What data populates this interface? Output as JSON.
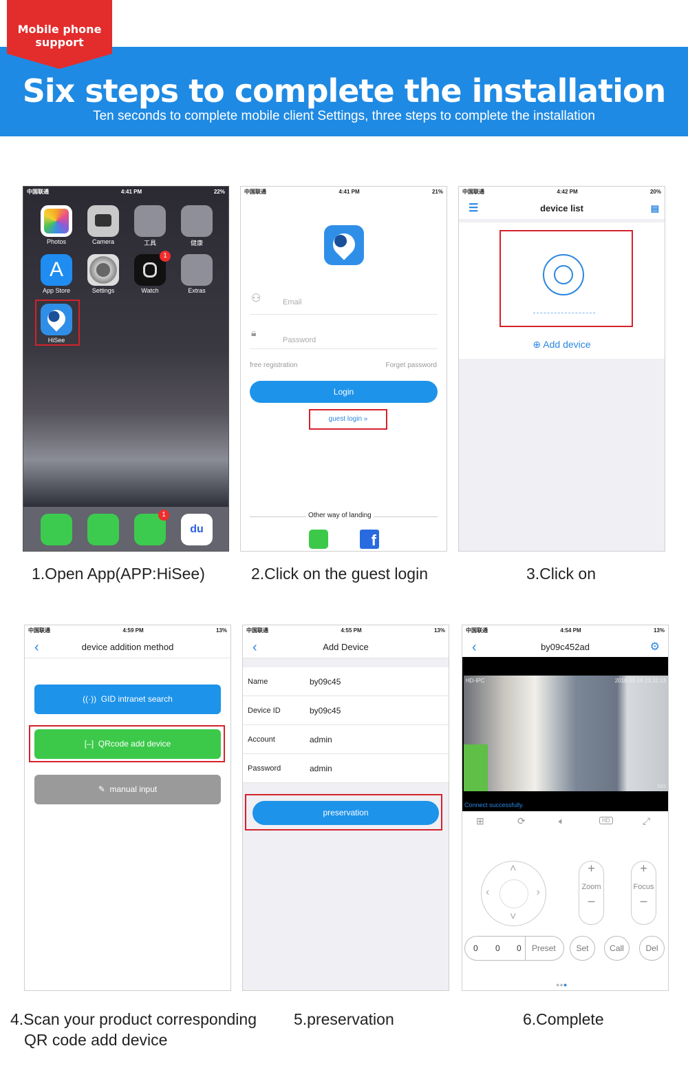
{
  "header": {
    "badge": "Mobile phone support",
    "title": "Six steps to complete the installation",
    "subtitle": "Ten seconds to complete mobile client Settings, three steps to complete the installation"
  },
  "colors": {
    "brand_blue": "#1f8ae3",
    "badge_red": "#e32c2c",
    "highlight_red": "#d4222a",
    "button_blue": "#1e93ea",
    "button_green": "#3cc94a",
    "button_gray": "#9a9a9a"
  },
  "status": {
    "carrier": "中国联通"
  },
  "step1": {
    "time": "4:41 PM",
    "battery": "22%",
    "apps": [
      {
        "label": "Photos"
      },
      {
        "label": "Camera"
      },
      {
        "label": "工具"
      },
      {
        "label": "健康"
      },
      {
        "label": "App Store"
      },
      {
        "label": "Settings"
      },
      {
        "label": "Watch",
        "badge": "1"
      },
      {
        "label": "Extras"
      },
      {
        "label": "HiSee"
      }
    ],
    "dock_badge": "1",
    "caption": "1.Open App(APP:HiSee)"
  },
  "step2": {
    "time": "4:41 PM",
    "battery": "21%",
    "email_placeholder": "Email",
    "password_placeholder": "Password",
    "free_registration": "free registration",
    "forget_password": "Forget password",
    "login": "Login",
    "guest_login": "guest login",
    "other_way": "Other way of landing",
    "caption": "2.Click on the guest login"
  },
  "step3": {
    "time": "4:42 PM",
    "battery": "20%",
    "title": "device list",
    "add_device": "Add device",
    "caption": "3.Click on"
  },
  "step4": {
    "time": "4:59 PM",
    "battery": "13%",
    "title": "device addition method",
    "buttons": [
      "GID intranet search",
      "QRcode add device",
      "manual input"
    ],
    "caption_line1": "4.Scan your product corresponding",
    "caption_line2": "QR code add device"
  },
  "step5": {
    "time": "4:55 PM",
    "battery": "13%",
    "title": "Add Device",
    "rows": [
      {
        "key": "Name",
        "value": "by09c45"
      },
      {
        "key": "Device ID",
        "value": "by09c45"
      },
      {
        "key": "Account",
        "value": "admin"
      },
      {
        "key": "Password",
        "value": "admin"
      }
    ],
    "save": "preservation",
    "caption": "5.preservation"
  },
  "step6": {
    "time": "4:54 PM",
    "battery": "13%",
    "title": "by09c452ad",
    "overlay_left": "HD-IPC",
    "overlay_time": "2018-03-16 23:32:13",
    "overlay_ch": "X01",
    "connect": "Connect successfully.",
    "hd": "HD",
    "zoom": "Zoom",
    "focus": "Focus",
    "preset_values": [
      "0",
      "0",
      "0"
    ],
    "preset": "Preset",
    "set": "Set",
    "call": "Call",
    "del": "Del",
    "caption": "6.Complete"
  }
}
